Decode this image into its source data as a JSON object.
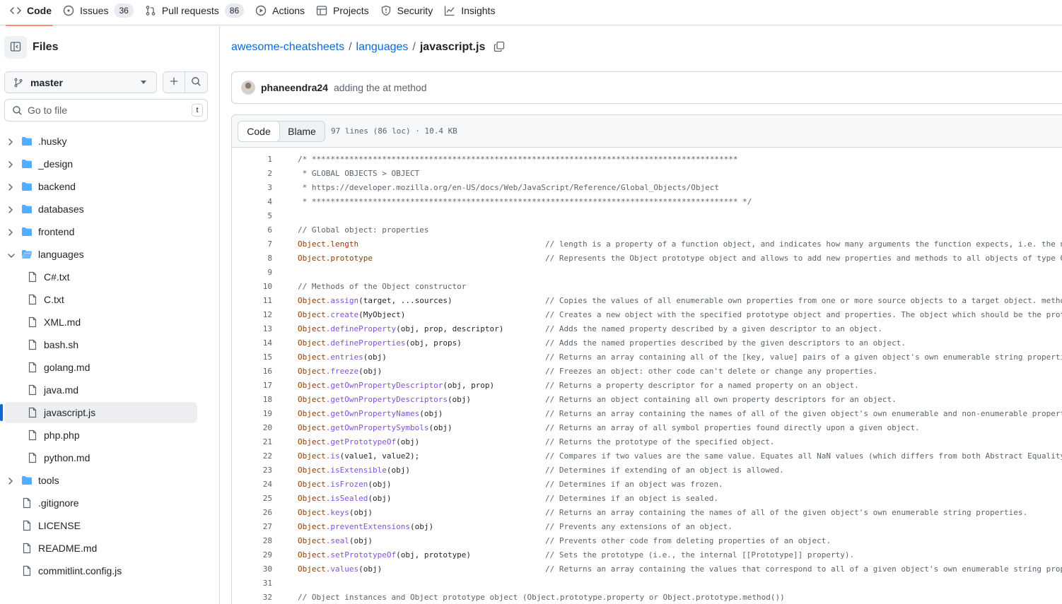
{
  "repo_nav": {
    "tabs": [
      {
        "label": "Code",
        "icon": "code-icon",
        "active": true,
        "count": ""
      },
      {
        "label": "Issues",
        "icon": "issue-opened-icon",
        "active": false,
        "count": "36"
      },
      {
        "label": "Pull requests",
        "icon": "git-pull-request-icon",
        "active": false,
        "count": "86"
      },
      {
        "label": "Actions",
        "icon": "play-icon",
        "active": false,
        "count": ""
      },
      {
        "label": "Projects",
        "icon": "table-icon",
        "active": false,
        "count": ""
      },
      {
        "label": "Security",
        "icon": "shield-icon",
        "active": false,
        "count": ""
      },
      {
        "label": "Insights",
        "icon": "graph-icon",
        "active": false,
        "count": ""
      }
    ]
  },
  "sidebar": {
    "title": "Files",
    "branch": "master",
    "search_placeholder": "Go to file",
    "search_shortcut": "t",
    "tree": [
      {
        "name": ".husky",
        "type": "dir",
        "expanded": false,
        "depth": 0
      },
      {
        "name": "_design",
        "type": "dir",
        "expanded": false,
        "depth": 0
      },
      {
        "name": "backend",
        "type": "dir",
        "expanded": false,
        "depth": 0
      },
      {
        "name": "databases",
        "type": "dir",
        "expanded": false,
        "depth": 0
      },
      {
        "name": "frontend",
        "type": "dir",
        "expanded": false,
        "depth": 0
      },
      {
        "name": "languages",
        "type": "dir",
        "expanded": true,
        "depth": 0
      },
      {
        "name": "C#.txt",
        "type": "file",
        "depth": 1
      },
      {
        "name": "C.txt",
        "type": "file",
        "depth": 1
      },
      {
        "name": "XML.md",
        "type": "file",
        "depth": 1
      },
      {
        "name": "bash.sh",
        "type": "file",
        "depth": 1
      },
      {
        "name": "golang.md",
        "type": "file",
        "depth": 1
      },
      {
        "name": "java.md",
        "type": "file",
        "depth": 1
      },
      {
        "name": "javascript.js",
        "type": "file",
        "depth": 1,
        "selected": true
      },
      {
        "name": "php.php",
        "type": "file",
        "depth": 1
      },
      {
        "name": "python.md",
        "type": "file",
        "depth": 1
      },
      {
        "name": "tools",
        "type": "dir",
        "expanded": false,
        "depth": 0
      },
      {
        "name": ".gitignore",
        "type": "file",
        "depth": 0
      },
      {
        "name": "LICENSE",
        "type": "file",
        "depth": 0
      },
      {
        "name": "README.md",
        "type": "file",
        "depth": 0
      },
      {
        "name": "commitlint.config.js",
        "type": "file",
        "depth": 0
      }
    ]
  },
  "breadcrumb": {
    "repo": "awesome-cheatsheets",
    "dir": "languages",
    "file": "javascript.js",
    "sep": "/"
  },
  "commit": {
    "author": "phaneendra24",
    "message": "adding the at method"
  },
  "file_header": {
    "code_tab": "Code",
    "blame_tab": "Blame",
    "info": "97 lines (86 loc) · 10.4 KB"
  },
  "code_lines": [
    {
      "n": "1",
      "text": "/* *******************************************************************************************",
      "kind": "comment"
    },
    {
      "n": "2",
      "text": " * GLOBAL OBJECTS > OBJECT",
      "kind": "comment"
    },
    {
      "n": "3",
      "text": " * https://developer.mozilla.org/en-US/docs/Web/JavaScript/Reference/Global_Objects/Object",
      "kind": "comment"
    },
    {
      "n": "4",
      "text": " * ******************************************************************************************* */",
      "kind": "comment"
    },
    {
      "n": "5",
      "text": "",
      "kind": "plain"
    },
    {
      "n": "6",
      "text": "// Global object: properties",
      "kind": "comment"
    },
    {
      "n": "7",
      "obj": "Object",
      "member": ".length",
      "rest": "",
      "comment": "// length is a property of a function object, and indicates how many arguments the function expects, i.e. the n",
      "kind": "prop"
    },
    {
      "n": "8",
      "obj": "Object",
      "member": ".prototype",
      "rest": "",
      "comment": "// Represents the Object prototype object and allows to add new properties and methods to all objects of type O",
      "kind": "prop"
    },
    {
      "n": "9",
      "text": "",
      "kind": "plain"
    },
    {
      "n": "10",
      "text": "// Methods of the Object constructor",
      "kind": "comment"
    },
    {
      "n": "11",
      "obj": "Object",
      "member": ".assign",
      "rest": "(target, ...sources)",
      "comment": "// Copies the values of all enumerable own properties from one or more source objects to a target object. metho",
      "kind": "prop"
    },
    {
      "n": "12",
      "obj": "Object",
      "member": ".create",
      "rest": "(MyObject)",
      "comment": "// Creates a new object with the specified prototype object and properties. The object which should be the prot",
      "kind": "create"
    },
    {
      "n": "13",
      "obj": "Object",
      "member": ".defineProperty",
      "rest": "(obj, prop, descriptor)",
      "comment": "// Adds the named property described by a given descriptor to an object.",
      "kind": "prop"
    },
    {
      "n": "14",
      "obj": "Object",
      "member": ".defineProperties",
      "rest": "(obj, props)",
      "comment": "// Adds the named properties described by the given descriptors to an object.",
      "kind": "prop"
    },
    {
      "n": "15",
      "obj": "Object",
      "member": ".entries",
      "rest": "(obj)",
      "comment": "// Returns an array containing all of the [key, value] pairs of a given object's own enumerable string properti",
      "kind": "prop"
    },
    {
      "n": "16",
      "obj": "Object",
      "member": ".freeze",
      "rest": "(obj)",
      "comment": "// Freezes an object: other code can't delete or change any properties.",
      "kind": "prop"
    },
    {
      "n": "17",
      "obj": "Object",
      "member": ".getOwnPropertyDescriptor",
      "rest": "(obj, prop)",
      "comment": "// Returns a property descriptor for a named property on an object.",
      "kind": "prop"
    },
    {
      "n": "18",
      "obj": "Object",
      "member": ".getOwnPropertyDescriptors",
      "rest": "(obj)",
      "comment": "// Returns an object containing all own property descriptors for an object.",
      "kind": "prop"
    },
    {
      "n": "19",
      "obj": "Object",
      "member": ".getOwnPropertyNames",
      "rest": "(obj)",
      "comment": "// Returns an array containing the names of all of the given object's own enumerable and non-enumerable propert",
      "kind": "prop"
    },
    {
      "n": "20",
      "obj": "Object",
      "member": ".getOwnPropertySymbols",
      "rest": "(obj)",
      "comment": "// Returns an array of all symbol properties found directly upon a given object.",
      "kind": "prop"
    },
    {
      "n": "21",
      "obj": "Object",
      "member": ".getPrototypeOf",
      "rest": "(obj)",
      "comment": "// Returns the prototype of the specified object.",
      "kind": "prop"
    },
    {
      "n": "22",
      "obj": "Object",
      "member": ".is",
      "rest": "(value1, value2);",
      "comment": "// Compares if two values are the same value. Equates all NaN values (which differs from both Abstract Equality",
      "kind": "prop"
    },
    {
      "n": "23",
      "obj": "Object",
      "member": ".isExtensible",
      "rest": "(obj)",
      "comment": "// Determines if extending of an object is allowed.",
      "kind": "prop"
    },
    {
      "n": "24",
      "obj": "Object",
      "member": ".isFrozen",
      "rest": "(obj)",
      "comment": "// Determines if an object was frozen.",
      "kind": "prop"
    },
    {
      "n": "25",
      "obj": "Object",
      "member": ".isSealed",
      "rest": "(obj)",
      "comment": "// Determines if an object is sealed.",
      "kind": "prop"
    },
    {
      "n": "26",
      "obj": "Object",
      "member": ".keys",
      "rest": "(obj)",
      "comment": "// Returns an array containing the names of all of the given object's own enumerable string properties.",
      "kind": "prop"
    },
    {
      "n": "27",
      "obj": "Object",
      "member": ".preventExtensions",
      "rest": "(obj)",
      "comment": "// Prevents any extensions of an object.",
      "kind": "prop"
    },
    {
      "n": "28",
      "obj": "Object",
      "member": ".seal",
      "rest": "(obj)",
      "comment": "// Prevents other code from deleting properties of an object.",
      "kind": "prop"
    },
    {
      "n": "29",
      "obj": "Object",
      "member": ".setPrototypeOf",
      "rest": "(obj, prototype)",
      "comment": "// Sets the prototype (i.e., the internal [[Prototype]] property).",
      "kind": "prop"
    },
    {
      "n": "30",
      "obj": "Object",
      "member": ".values",
      "rest": "(obj)",
      "comment": "// Returns an array containing the values that correspond to all of a given object's own enumerable string prop",
      "kind": "prop"
    },
    {
      "n": "31",
      "text": "",
      "kind": "plain"
    },
    {
      "n": "32",
      "text": "// Object instances and Object prototype object (Object.prototype.property or Object.prototype.method())",
      "kind": "comment"
    }
  ],
  "colors": {
    "accent_link": "#0969da",
    "active_tab_underline": "#fd8c73",
    "folder": "#54aeff",
    "code_object": "#953800",
    "code_function": "#8250df",
    "code_comment": "#59636e"
  }
}
